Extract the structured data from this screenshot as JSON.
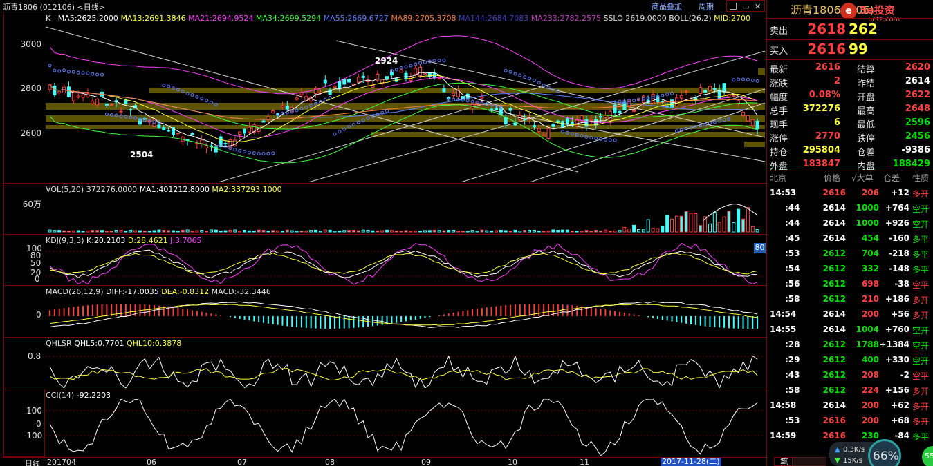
{
  "window": {
    "title": "沥青1806 (012106) <日线>",
    "menu_goods": "商品叠加",
    "menu_period": "周期"
  },
  "ma_line": {
    "k": "K",
    "ma5": "MA5:2625.2000",
    "ma13": "MA13:2691.3846",
    "ma21": "MA21:2694.9524",
    "ma34": "MA34:2699.5294",
    "ma55": "MA55:2669.6727",
    "ma89": "MA89:2705.3708",
    "ma144": "MA144:2684.7083",
    "ma233": "MA233:2782.2575",
    "sslo": "SSLO",
    "sslo_val": "2619.0000",
    "boll": "BOLL(26,2)",
    "mid": "MID:2700"
  },
  "colors": {
    "ma5": "#ffffff",
    "ma13": "#ffff40",
    "ma21": "#ff40ff",
    "ma34": "#40ff40",
    "ma55": "#6080ff",
    "ma89": "#ff8040",
    "ma144": "#4040c0",
    "ma233": "#c040c0",
    "up": "#ff4040",
    "down": "#40ffff",
    "band": "#706800"
  },
  "price_axis": [
    "3000",
    "2800",
    "2600"
  ],
  "annotations": {
    "high": "2924",
    "low": "2504"
  },
  "vol": {
    "label": "VOL(5,20)",
    "value": "372276.0000",
    "ma1": "MA1:401212.8000",
    "ma2": "MA2:337293.1000",
    "axis": "60万"
  },
  "kdj": {
    "label": "KDJ(9,3,3)",
    "k": "K:20.2103",
    "d": "D:28.4621",
    "j": "J:3.7065",
    "axis": [
      "100",
      "80",
      "50",
      "20",
      "0"
    ],
    "badge": "80"
  },
  "macd": {
    "label": "MACD(26,12,9)",
    "diff": "DIFF:-17.0035",
    "dea": "DEA:-0.8312",
    "macd": "MACD:-32.3446",
    "axis": "0"
  },
  "qhlsr": {
    "label": "QHLSR",
    "qhl5": "QHL5:0.7701",
    "qhl10": "QHL10:0.3878",
    "axis": "0.8"
  },
  "cci": {
    "label": "CCI(14)",
    "value": "-92.2203",
    "axis": [
      "100",
      "0",
      "-100"
    ]
  },
  "x_axis": {
    "period": "日线",
    "labels": [
      "201704",
      "06",
      "07",
      "08",
      "09",
      "10",
      "11"
    ],
    "cursor_date": "2017-11-28(二)"
  },
  "side": {
    "title": "沥青1806 (b",
    "title_tail": "06)",
    "logo_text": "5etz.com",
    "brand": "5e投资",
    "sell": {
      "label": "卖出",
      "price": "2618",
      "qty": "262"
    },
    "buy": {
      "label": "买入",
      "price": "2616",
      "qty": "99"
    },
    "quotes": [
      {
        "l1": "最新",
        "v1": "2616",
        "c1": "red",
        "l2": "结算",
        "v2": "2620",
        "c2": "red"
      },
      {
        "l1": "涨跌",
        "v1": "2",
        "c1": "red",
        "l2": "昨结",
        "v2": "2614",
        "c2": "white"
      },
      {
        "l1": "幅度",
        "v1": "0.08%",
        "c1": "red",
        "l2": "开盘",
        "v2": "2622",
        "c2": "red"
      },
      {
        "l1": "总手",
        "v1": "372276",
        "c1": "yellow",
        "l2": "最高",
        "v2": "2648",
        "c2": "red"
      },
      {
        "l1": "现手",
        "v1": "6",
        "c1": "yellow",
        "l2": "最低",
        "v2": "2596",
        "c2": "green"
      },
      {
        "l1": "涨停",
        "v1": "2770",
        "c1": "red",
        "l2": "跌停",
        "v2": "2456",
        "c2": "green"
      },
      {
        "l1": "持仓",
        "v1": "295804",
        "c1": "yellow",
        "l2": "仓差",
        "v2": "-9386",
        "c2": "white"
      },
      {
        "l1": "外盘",
        "v1": "183847",
        "c1": "red",
        "l2": "内盘",
        "v2": "188429",
        "c2": "green"
      }
    ],
    "tick_header": {
      "time": "北京",
      "price": "价格",
      "vol": "√大单",
      "chg": "仓差",
      "type": "性质"
    },
    "ticks": [
      {
        "t": "14:53",
        "p": "2616",
        "pc": "red",
        "v": "206",
        "vc": "red",
        "c": "+12",
        "x": "多开",
        "xc": "red"
      },
      {
        "t": ":44",
        "p": "2614",
        "pc": "white",
        "v": "1000",
        "vc": "green",
        "c": "+764",
        "x": "空开",
        "xc": "green"
      },
      {
        "t": ":44",
        "p": "2614",
        "pc": "white",
        "v": "1000",
        "vc": "green",
        "c": "+926",
        "x": "空开",
        "xc": "green"
      },
      {
        "t": ":45",
        "p": "2614",
        "pc": "white",
        "v": "454",
        "vc": "green",
        "c": "-160",
        "x": "多平",
        "xc": "green"
      },
      {
        "t": ":53",
        "p": "2612",
        "pc": "green",
        "v": "704",
        "vc": "green",
        "c": "-218",
        "x": "多平",
        "xc": "green"
      },
      {
        "t": ":54",
        "p": "2612",
        "pc": "green",
        "v": "332",
        "vc": "green",
        "c": "-148",
        "x": "多平",
        "xc": "green"
      },
      {
        "t": ":56",
        "p": "2612",
        "pc": "green",
        "v": "698",
        "vc": "red",
        "c": "-38",
        "x": "空平",
        "xc": "red"
      },
      {
        "t": ":58",
        "p": "2612",
        "pc": "green",
        "v": "210",
        "vc": "red",
        "c": "+186",
        "x": "多开",
        "xc": "red"
      },
      {
        "t": "14:54",
        "p": "2614",
        "pc": "white",
        "v": "200",
        "vc": "red",
        "c": "+56",
        "x": "多开",
        "xc": "red"
      },
      {
        "t": "14:55",
        "p": "2614",
        "pc": "white",
        "v": "1004",
        "vc": "green",
        "c": "+760",
        "x": "空开",
        "xc": "green"
      },
      {
        "t": ":28",
        "p": "2612",
        "pc": "green",
        "v": "1788",
        "vc": "green",
        "c": "+1384",
        "x": "空开",
        "xc": "green"
      },
      {
        "t": ":29",
        "p": "2612",
        "pc": "green",
        "v": "400",
        "vc": "green",
        "c": "+330",
        "x": "空开",
        "xc": "green"
      },
      {
        "t": ":43",
        "p": "2612",
        "pc": "green",
        "v": "208",
        "vc": "red",
        "c": "-2",
        "x": "空平",
        "xc": "red"
      },
      {
        "t": ":58",
        "p": "2612",
        "pc": "green",
        "v": "224",
        "vc": "red",
        "c": "+156",
        "x": "多开",
        "xc": "red"
      },
      {
        "t": "14:58",
        "p": "2614",
        "pc": "white",
        "v": "200",
        "vc": "red",
        "c": "+62",
        "x": "多开",
        "xc": "red"
      },
      {
        "t": ":53",
        "p": "2616",
        "pc": "red",
        "v": "200",
        "vc": "red",
        "c": "+68",
        "x": "多开",
        "xc": "red"
      },
      {
        "t": "14:59",
        "p": "2616",
        "pc": "red",
        "v": "230",
        "vc": "green",
        "c": "-84",
        "x": "多平",
        "xc": "green"
      }
    ],
    "footer_tab": "笔",
    "gauge_value": "66%",
    "speed_up": "0.3K/s",
    "speed_down": "15K/s",
    "side_badge": "55"
  }
}
